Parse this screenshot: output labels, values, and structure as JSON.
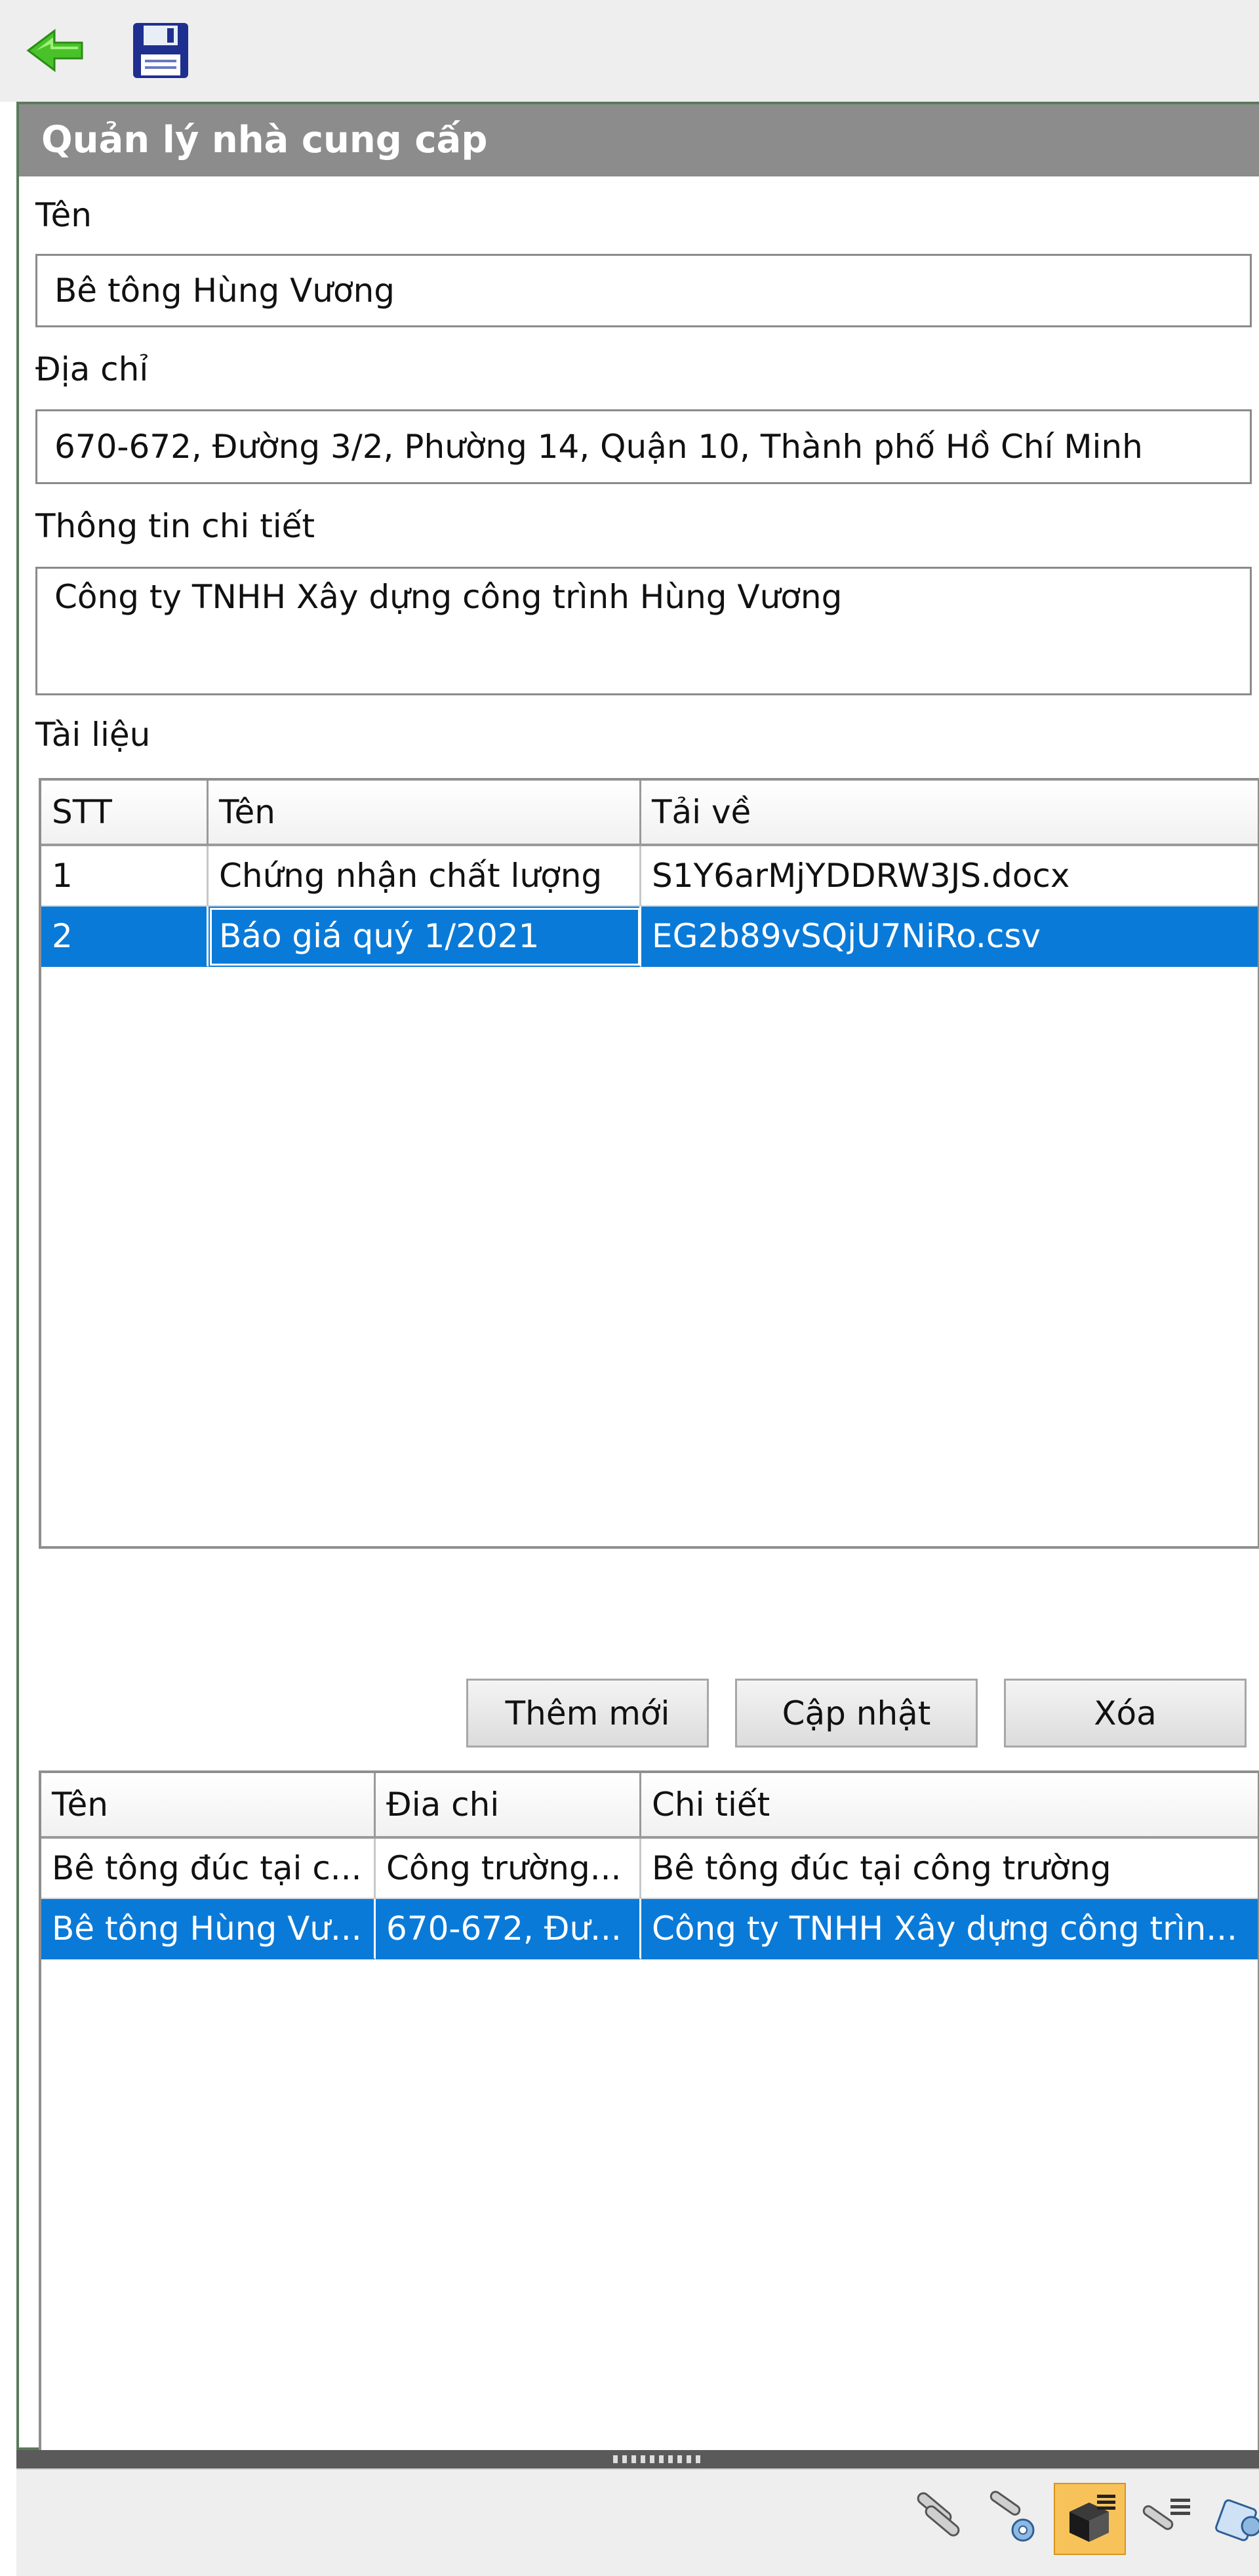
{
  "toolbar": {
    "back_icon": "green-left-arrow-icon",
    "save_icon": "floppy-disk-icon"
  },
  "panel": {
    "title": "Quản lý nhà cung cấp",
    "name_label": "Tên",
    "name_value": "Bê tông Hùng Vương",
    "address_label": "Địa chỉ",
    "address_value": "670-672, Đường 3/2, Phường 14, Quận 10, Thành phố Hồ Chí Minh",
    "detail_label": "Thông tin chi tiết",
    "detail_value": "Công ty TNHH Xây dựng công trình Hùng Vương",
    "docs_label": "Tài liệu"
  },
  "documents": {
    "columns": [
      "STT",
      "Tên",
      "Tải về"
    ],
    "rows": [
      [
        "1",
        "Chứng nhận chất lượng",
        "S1Y6arMjYDDRW3JS.docx"
      ],
      [
        "2",
        "Báo giá quý 1/2021",
        "EG2b89vSQjU7NiRo.csv"
      ]
    ],
    "selected_row": 2
  },
  "actions": {
    "add": "Thêm mới",
    "update": "Cập nhật",
    "delete": "Xóa"
  },
  "suppliers": {
    "columns": [
      "Tên",
      "Đia chi",
      "Chi tiết"
    ],
    "rows": [
      [
        "Bê tông đúc tại c...",
        "Công trường...",
        "Bê tông đúc tại công trường"
      ],
      [
        "Bê tông Hùng Vư...",
        "670-672, Đư...",
        "Công ty TNHH Xây dựng công trìn..."
      ]
    ],
    "selected_row": 2
  },
  "statusbar": {
    "icons": [
      "pipes-icon",
      "pipe-settings-icon",
      "package-list-icon",
      "pipe-list-icon",
      "pipe-network-icon"
    ],
    "active_icon": "package-list-icon"
  },
  "colors": {
    "selection": "#0a7ad8",
    "header": "#8c8c8c",
    "active_tool": "#f7c25a"
  }
}
